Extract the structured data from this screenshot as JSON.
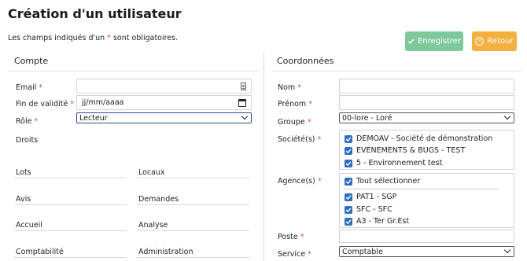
{
  "page": {
    "title": "Création d'un utilisateur",
    "required_note_before": "Les champs indiqués d'un ",
    "required_star": "*",
    "required_note_after": " sont obligatoires."
  },
  "toolbar": {
    "save_label": "Enregistrer",
    "back_label": "Retour",
    "save_color": "#7ec99b",
    "back_color": "#f5b140"
  },
  "compte": {
    "section_title": "Compte",
    "email_label": "Email",
    "email_value": "",
    "validity_label": "Fin de validité",
    "validity_placeholder": "jj/mm/aaaa",
    "role_label": "Rôle",
    "role_value": "Lecteur",
    "droits_label": "Droits",
    "droits": [
      "Lots",
      "Locaux",
      "Avis",
      "Demandes",
      "Accueil",
      "Analyse",
      "Comptabilité",
      "Administration"
    ]
  },
  "coordonnees": {
    "section_title": "Coordonnées",
    "nom_label": "Nom",
    "prenom_label": "Prénom",
    "groupe_label": "Groupe",
    "groupe_value": "00-lore - Loré",
    "societes_label": "Société(s)",
    "societes": [
      {
        "label": "DEMOAV - Société de démonstration",
        "checked": true
      },
      {
        "label": "EVENEMENTS & BUGS - TEST",
        "checked": true
      },
      {
        "label": "5 - Environnement test",
        "checked": true
      }
    ],
    "agences_label": "Agence(s)",
    "agences_select_all": "Tout sélectionner",
    "agences": [
      {
        "label": "PAT1 - SGP",
        "checked": true
      },
      {
        "label": "SFC - SFC",
        "checked": true
      },
      {
        "label": "A3 - Ter Gr.Est",
        "checked": true
      }
    ],
    "poste_label": "Poste",
    "service_label": "Service",
    "service_value": "Comptable"
  },
  "icons": {
    "save": "check-icon",
    "back": "close-circle-icon",
    "email_field": "contact-card-icon",
    "date_field": "calendar-icon",
    "dropdown": "chevron-down-icon",
    "checkbox": "checkmark-icon"
  }
}
